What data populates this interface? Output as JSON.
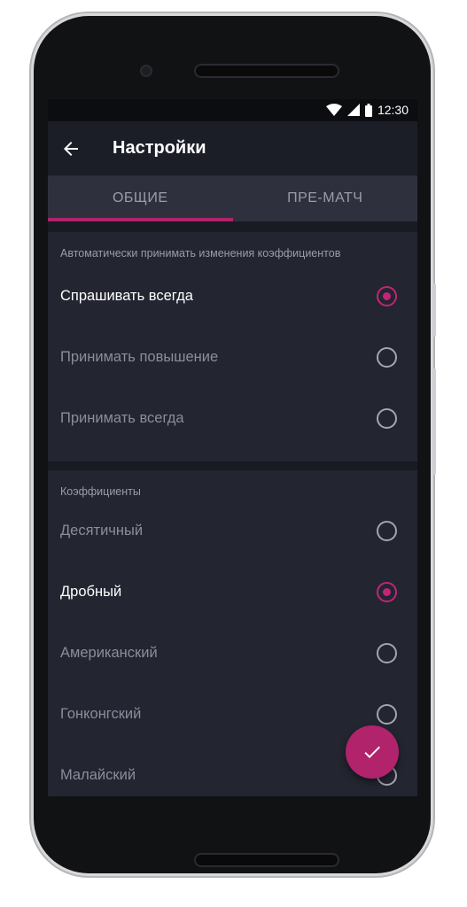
{
  "status_bar": {
    "time": "12:30"
  },
  "app_bar": {
    "title": "Настройки"
  },
  "tabs": [
    {
      "label": "ОБЩИЕ",
      "active": true
    },
    {
      "label": "ПРЕ-МАТЧ",
      "active": false
    }
  ],
  "sections": [
    {
      "header": "Автоматически принимать изменения коэффициентов",
      "options": [
        {
          "label": "Спрашивать всегда",
          "selected": true
        },
        {
          "label": "Принимать повышение",
          "selected": false
        },
        {
          "label": "Принимать всегда",
          "selected": false
        }
      ]
    },
    {
      "header": "Коэффициенты",
      "options": [
        {
          "label": "Десятичный",
          "selected": false
        },
        {
          "label": "Дробный",
          "selected": true
        },
        {
          "label": "Американский",
          "selected": false
        },
        {
          "label": "Гонконгский",
          "selected": false
        },
        {
          "label": "Малайский",
          "selected": false
        }
      ]
    }
  ],
  "colors": {
    "accent": "#b0226a",
    "background": "#20222c",
    "tab_bar": "#2e313d"
  },
  "icons": {
    "back": "arrow-back-icon",
    "fab": "check-icon"
  }
}
